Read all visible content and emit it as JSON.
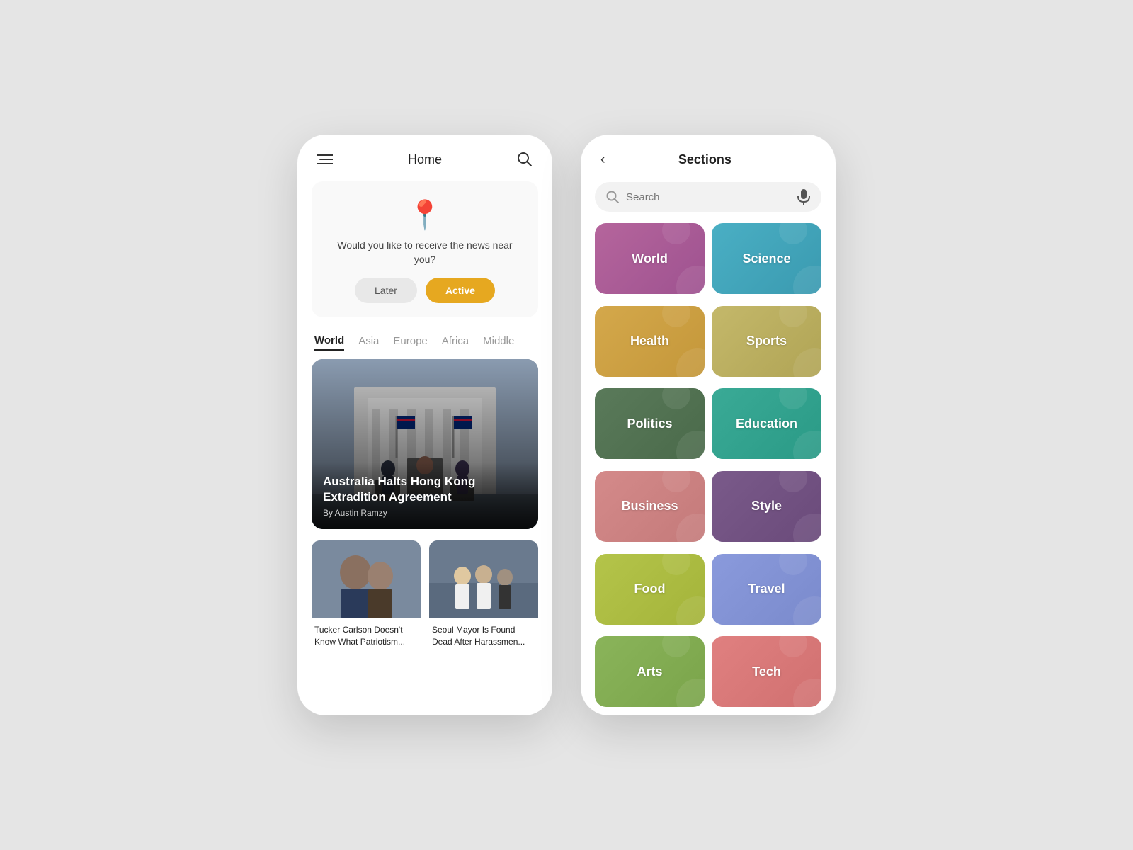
{
  "leftPhone": {
    "header": {
      "title": "Home",
      "menuIcon": "≡",
      "searchIcon": "🔍"
    },
    "locationCard": {
      "icon": "📍",
      "message": "Would you like to receive the news near you?",
      "laterLabel": "Later",
      "activeLabel": "Active"
    },
    "categories": [
      {
        "label": "World",
        "active": true
      },
      {
        "label": "Asia",
        "active": false
      },
      {
        "label": "Europe",
        "active": false
      },
      {
        "label": "Africa",
        "active": false
      },
      {
        "label": "Middle",
        "active": false
      }
    ],
    "mainArticle": {
      "headline": "Australia Halts Hong Kong Extradition Agreement",
      "author": "By Austin Ramzy"
    },
    "smallArticles": [
      {
        "headline": "Tucker Carlson Doesn't Know What Patriotism..."
      },
      {
        "headline": "Seoul Mayor Is Found Dead After Harassmen..."
      }
    ]
  },
  "rightPhone": {
    "header": {
      "title": "Sections",
      "backLabel": "‹"
    },
    "search": {
      "placeholder": "Search"
    },
    "sections": [
      {
        "label": "World",
        "colorClass": "card-world"
      },
      {
        "label": "Science",
        "colorClass": "card-science"
      },
      {
        "label": "Health",
        "colorClass": "card-health"
      },
      {
        "label": "Sports",
        "colorClass": "card-sports"
      },
      {
        "label": "Politics",
        "colorClass": "card-politics"
      },
      {
        "label": "Education",
        "colorClass": "card-education"
      },
      {
        "label": "Business",
        "colorClass": "card-business"
      },
      {
        "label": "Style",
        "colorClass": "card-style"
      },
      {
        "label": "Food",
        "colorClass": "card-food"
      },
      {
        "label": "Travel",
        "colorClass": "card-travel"
      },
      {
        "label": "Arts",
        "colorClass": "card-more1"
      },
      {
        "label": "Tech",
        "colorClass": "card-more2"
      }
    ]
  }
}
